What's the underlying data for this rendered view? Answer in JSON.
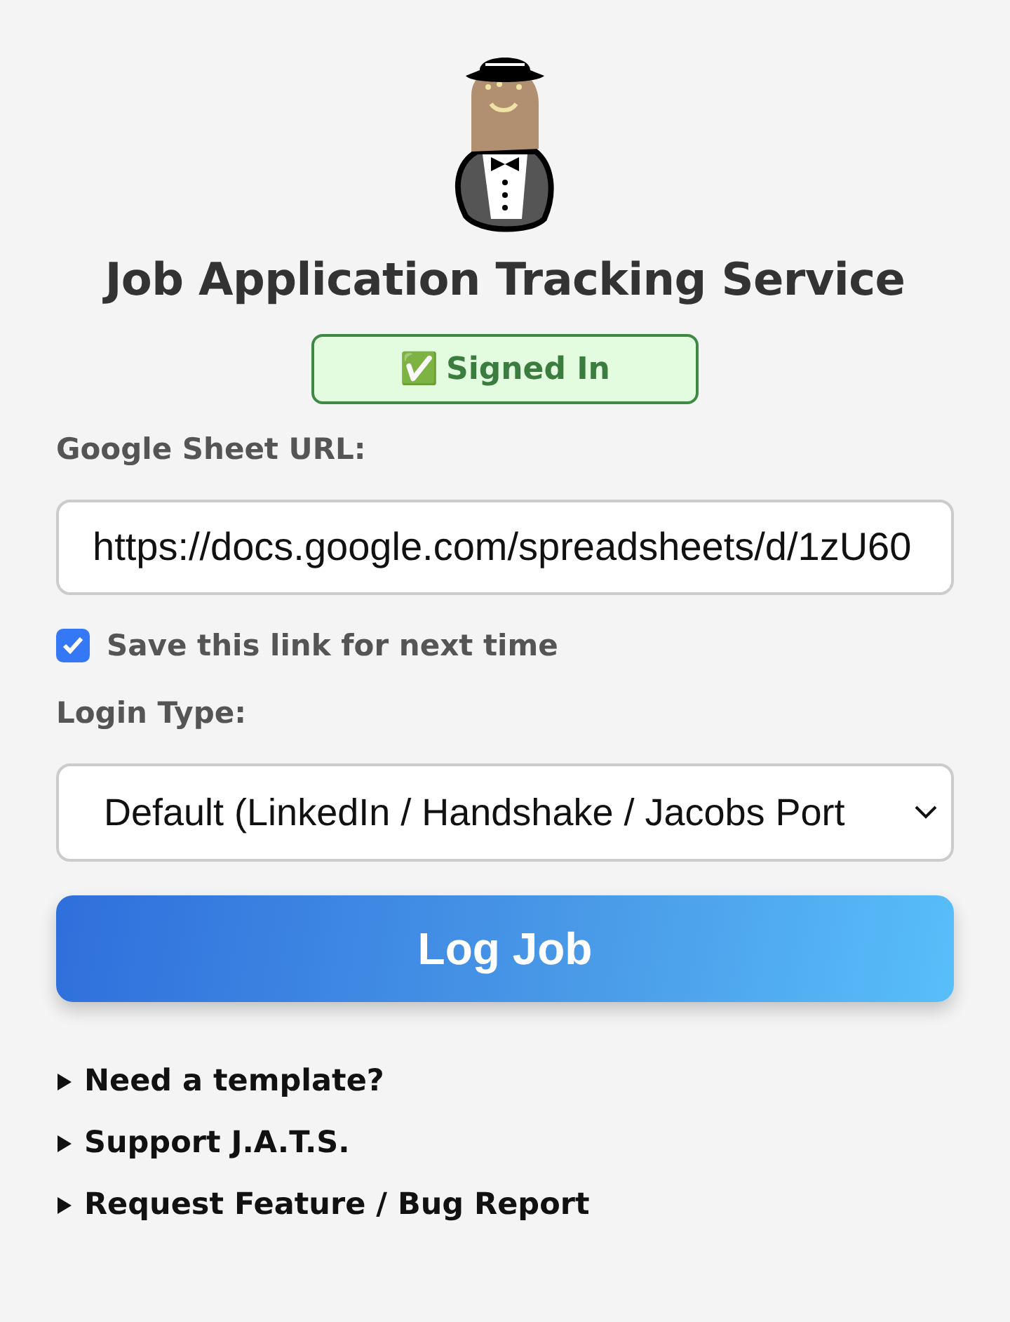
{
  "title": "Job Application Tracking Service",
  "status": {
    "icon": "✅",
    "label": "Signed In",
    "signed_in": true
  },
  "sheet_url": {
    "label": "Google Sheet URL:",
    "value": "https://docs.google.com/spreadsheets/d/1zU60"
  },
  "save_link": {
    "label": "Save this link for next time",
    "checked": true
  },
  "login_type": {
    "label": "Login Type:",
    "value": "Default (LinkedIn / Handshake / Jacobs Port"
  },
  "submit": "Log Job",
  "sections": [
    {
      "label": "Need a template?",
      "expanded": false
    },
    {
      "label": "Support J.A.T.S.",
      "expanded": false
    },
    {
      "label": "Request Feature / Bug Report",
      "expanded": false
    }
  ]
}
